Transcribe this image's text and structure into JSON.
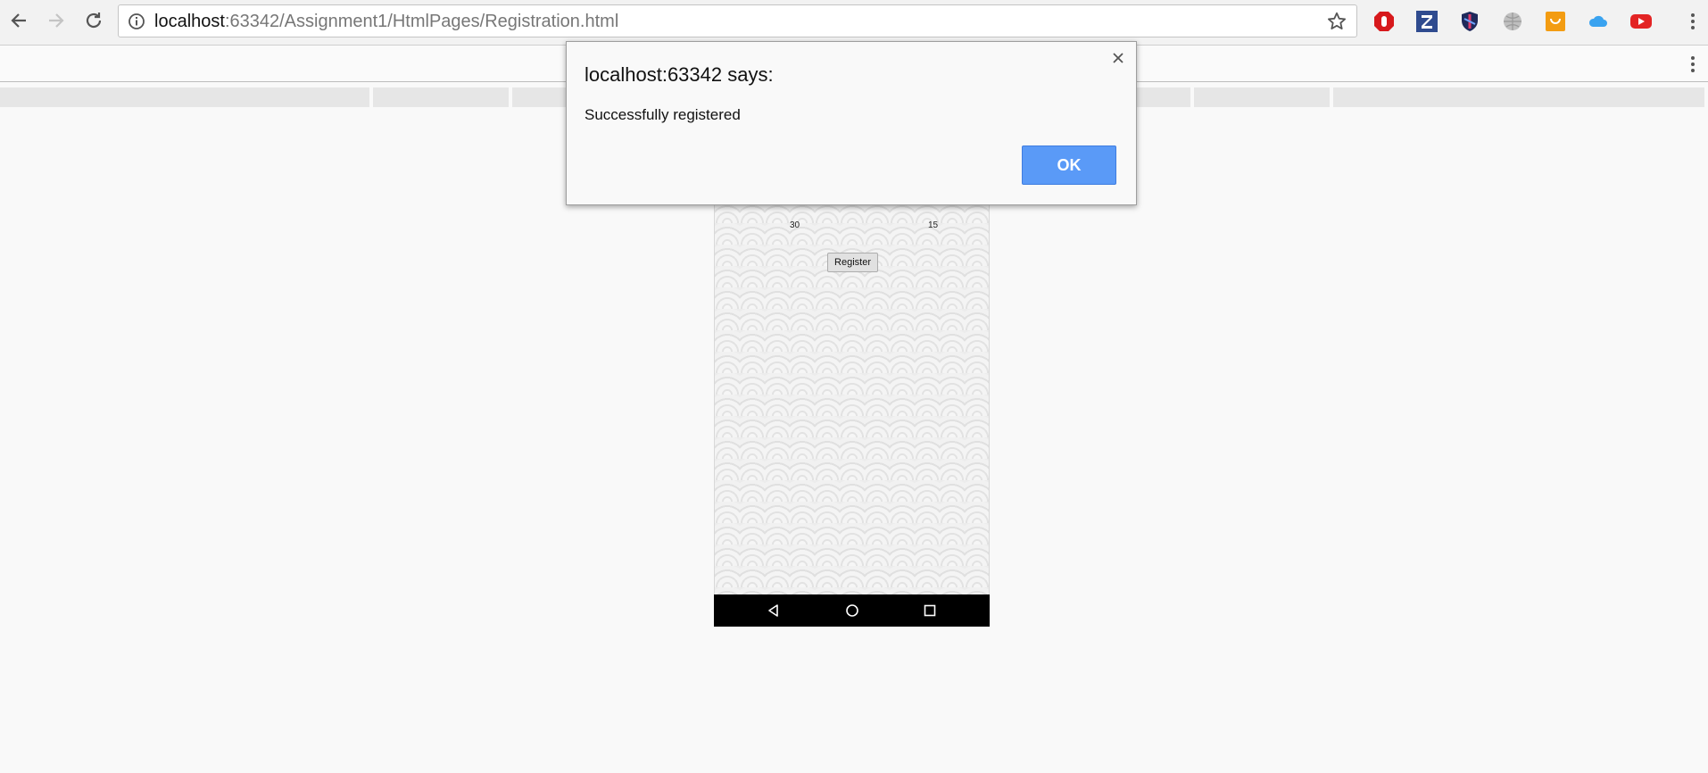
{
  "browser": {
    "url_host": "localhost",
    "url_rest": ":63342/Assignment1/HtmlPages/Registration.html",
    "extensions": [
      "stop-icon",
      "zotero-icon",
      "shield-icon",
      "globe-icon",
      "cart-icon",
      "cloud-icon",
      "youtube-icon"
    ]
  },
  "phone": {
    "value_left": "30",
    "value_right": "15",
    "register_label": "Register"
  },
  "dialog": {
    "title": "localhost:63342 says:",
    "message": "Successfully registered",
    "ok_label": "OK"
  },
  "colors": {
    "ok_button": "#5a9af7",
    "dialog_bg": "#f9f9f9",
    "phone_nav": "#000000"
  }
}
